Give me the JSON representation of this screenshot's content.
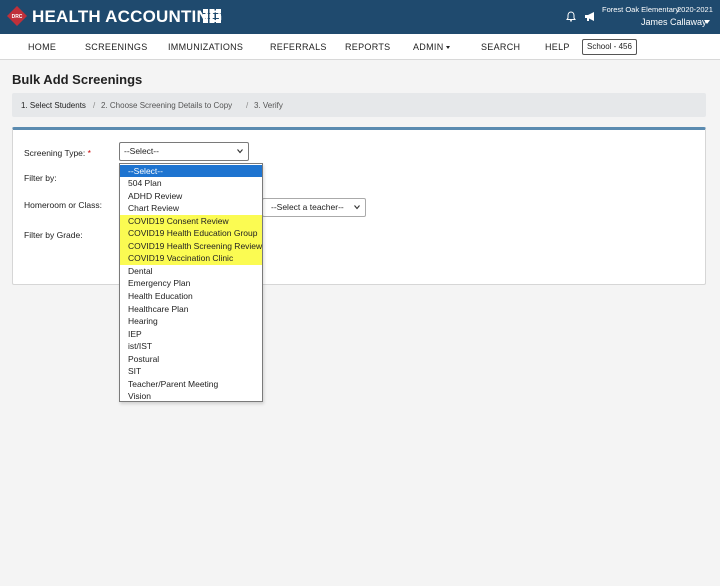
{
  "header": {
    "logo_text": "DRC",
    "app_title": "HEALTH ACCOUNTING",
    "school_name": "Forest Oak Elementary",
    "school_year": "2020-2021",
    "user_name": "James Callaway",
    "icons": [
      "grid-icon",
      "bell-icon",
      "megaphone-icon"
    ],
    "brand_color": "#1f4a6e"
  },
  "nav": {
    "items": [
      "HOME",
      "SCREENINGS",
      "IMMUNIZATIONS",
      "REFERRALS",
      "REPORTS",
      "ADMIN",
      "SEARCH",
      "HELP"
    ],
    "school_chip": "School - 456"
  },
  "page": {
    "title": "Bulk Add Screenings",
    "breadcrumb": [
      "1. Select Students",
      "2. Choose Screening Details to Copy",
      "3. Verify"
    ],
    "breadcrumb_sep": "/"
  },
  "form": {
    "screening_type_label": "Screening Type:",
    "required_mark": "*",
    "screening_type_value": "--Select--",
    "filter_by_label": "Filter by:",
    "homeroom_label": "Homeroom or Class:",
    "teacher_select_value": "--Select a teacher--",
    "grade_label": "Filter by Grade:"
  },
  "dropdown": {
    "options": [
      "--Select--",
      "504 Plan",
      "ADHD Review",
      "Chart Review",
      "COVID19 Consent Review",
      "COVID19 Health Education Group",
      "COVID19 Health Screening Review",
      "COVID19 Vaccination Clinic",
      "Dental",
      "Emergency Plan",
      "Health Education",
      "Healthcare Plan",
      "Hearing",
      "IEP",
      "ist/IST",
      "Postural",
      "SIT",
      "Teacher/Parent Meeting",
      "Vision"
    ],
    "selected_index": 0,
    "highlighted_indices": [
      4,
      5,
      6,
      7
    ],
    "selected_color": "#1e74d0",
    "highlight_color": "#fbfb52"
  }
}
